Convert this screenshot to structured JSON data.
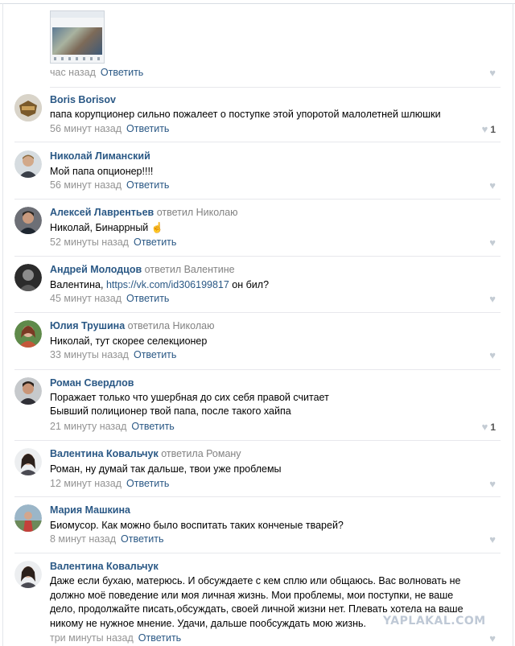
{
  "top_item": {
    "time": "час назад",
    "reply_label": "Ответить"
  },
  "comments": [
    {
      "author": "Boris Borisov",
      "reply_to": "",
      "lines": [
        "папа корупционер сильно пожалеет о поступке этой упоротой малолетней шлюшки"
      ],
      "time": "56 минут назад",
      "reply_label": "Ответить",
      "likes": "1"
    },
    {
      "author": "Николай Лиманский",
      "reply_to": "",
      "lines": [
        "Мой папа опционер!!!!"
      ],
      "time": "56 минут назад",
      "reply_label": "Ответить",
      "likes": ""
    },
    {
      "author": "Алексей Лаврентьев",
      "reply_to": "ответил Николаю",
      "lines": [
        "Николай, Бинаррный"
      ],
      "emoji": "☝",
      "time": "52 минуты назад",
      "reply_label": "Ответить",
      "likes": ""
    },
    {
      "author": "Андрей Молодцов",
      "reply_to": "ответил Валентине",
      "line_prefix": "Валентина, ",
      "link": "https://vk.com/id306199817",
      "line_suffix": " он бил?",
      "time": "45 минут назад",
      "reply_label": "Ответить",
      "likes": ""
    },
    {
      "author": "Юлия Трушина",
      "reply_to": "ответила Николаю",
      "lines": [
        "Николай, тут скорее селекционер"
      ],
      "time": "33 минуты назад",
      "reply_label": "Ответить",
      "likes": ""
    },
    {
      "author": "Роман Свердлов",
      "reply_to": "",
      "lines": [
        "Поражает только что ушербная до сих себя правой считает",
        "Бывший полиционер твой папа, после такого хайпа"
      ],
      "time": "21 минуту назад",
      "reply_label": "Ответить",
      "likes": "1"
    },
    {
      "author": "Валентина Ковальчук",
      "reply_to": "ответила Роману",
      "lines": [
        "Роман, ну думай так дальше, твои уже проблемы"
      ],
      "time": "12 минут назад",
      "reply_label": "Ответить",
      "likes": ""
    },
    {
      "author": "Мария Машкина",
      "reply_to": "",
      "lines": [
        "Биомусор. Как можно было воспитать таких конченые тварей?"
      ],
      "time": "8 минут назад",
      "reply_label": "Ответить",
      "likes": ""
    },
    {
      "author": "Валентина Ковальчук",
      "reply_to": "",
      "lines": [
        "Даже если бухаю, матерюсь. И обсуждаете с кем сплю или общаюсь. Вас волновать не",
        "должно моё поведение или моя личная жизнь. Мои проблемы, мои поступки, не ваше",
        "дело, продолжайте писать,обсуждать, своей личной жизни нет. Плевать хотела на ваше",
        "никому не нужное мнение. Удачи, дальше пообсуждать мою жизнь."
      ],
      "time": "три минуты назад",
      "reply_label": "Ответить",
      "likes": ""
    }
  ],
  "watermark": "YAPLAKAL.COM",
  "icons": {
    "like": "heart-icon"
  },
  "colors": {
    "name": "#2a5885",
    "meta": "#939393",
    "separator": "#e7e8ec"
  }
}
